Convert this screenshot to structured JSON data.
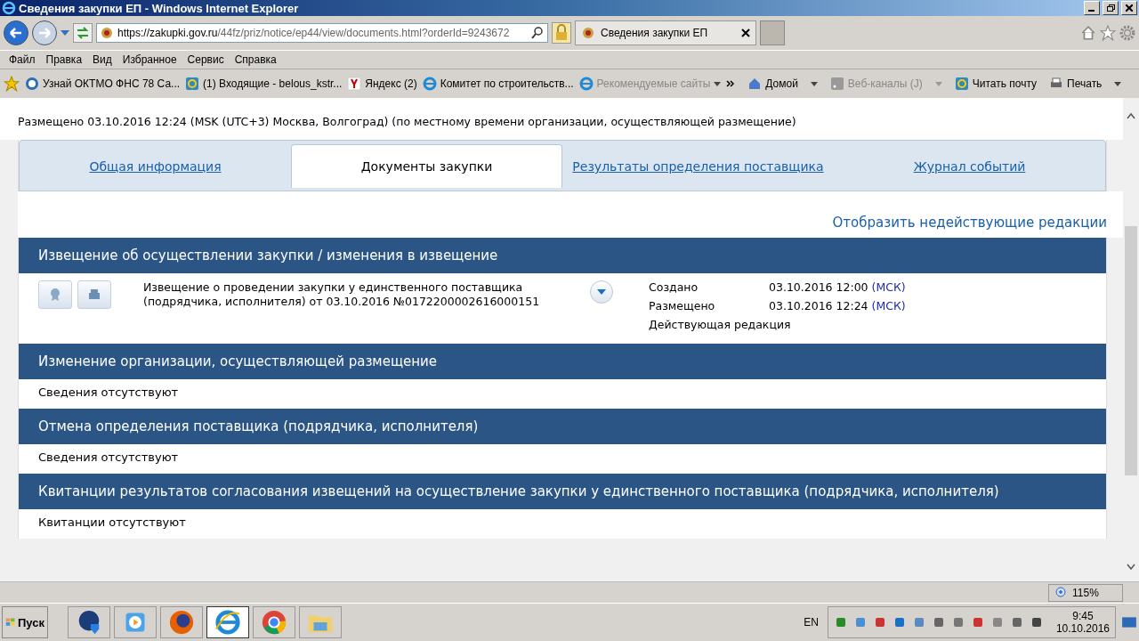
{
  "window": {
    "title": "Сведения закупки ЕП - Windows Internet Explorer"
  },
  "address": {
    "url_host": "https://zakupki.gov.ru",
    "url_path": "/44fz/priz/notice/ep44/view/documents.html?orderId=9243672"
  },
  "browser_tab": {
    "title": "Сведения закупки ЕП"
  },
  "menu": [
    "Файл",
    "Правка",
    "Вид",
    "Избранное",
    "Сервис",
    "Справка"
  ],
  "favorites": [
    {
      "label": "Узнай ОКТМО  ФНС  78 Са...",
      "kind": "site",
      "disabled": false
    },
    {
      "label": "(1) Входящие - belous_kstr...",
      "kind": "mail",
      "disabled": false
    },
    {
      "label": "Яндекс (2)",
      "kind": "yandex",
      "disabled": false
    },
    {
      "label": "Комитет по строительств...",
      "kind": "ie",
      "disabled": false
    },
    {
      "label": "Рекомендуемые сайты",
      "kind": "ie-menu",
      "disabled": true
    }
  ],
  "commands": [
    {
      "label": "Домой",
      "kind": "home",
      "disabled": false
    },
    {
      "label": "Веб-каналы (J)",
      "kind": "feed",
      "disabled": true
    },
    {
      "label": "Читать почту",
      "kind": "mail",
      "disabled": false
    },
    {
      "label": "Печать",
      "kind": "print",
      "disabled": false
    }
  ],
  "page": {
    "posted": "Размещено 03.10.2016 12:24 (MSK (UTC+3) Москва, Волгоград) (по местному времени организации, осуществляющей размещение)",
    "tabs": [
      {
        "label": "Общая информация",
        "selected": false
      },
      {
        "label": "Документы закупки",
        "selected": true
      },
      {
        "label": "Результаты определения поставщика",
        "selected": false
      },
      {
        "label": "Журнал событий",
        "selected": false
      }
    ],
    "show_link": "Отобразить недействующие редакции",
    "sections": [
      {
        "title": "Извещение об осуществлении закупки / изменения в извещение",
        "kind": "document",
        "document": {
          "lines": [
            "Извещение о проведении закупки у единственного поставщика",
            "(подрядчика, исполнителя) от 03.10.2016 №0172200002616000151"
          ],
          "meta": [
            {
              "label": "Создано",
              "value": "03.10.2016 12:00",
              "tz": "(МСК)"
            },
            {
              "label": "Размещено",
              "value": "03.10.2016 12:24",
              "tz": "(МСК)"
            }
          ],
          "status": "Действующая редакция"
        }
      },
      {
        "title": "Изменение организации, осуществляющей размещение",
        "kind": "empty",
        "text": "Сведения отсутствуют"
      },
      {
        "title": "Отмена определения поставщика (подрядчика, исполнителя)",
        "kind": "empty",
        "text": "Сведения отсутствуют"
      },
      {
        "title": "Квитанции результатов согласования извещений на осуществление закупки у единственного поставщика (подрядчика, исполнителя)",
        "kind": "empty",
        "text": "Квитанции отсутствуют"
      }
    ]
  },
  "status_bar": {
    "zoom": "115%"
  },
  "taskbar": {
    "start": "Пуск",
    "apps": [
      {
        "kind": "security",
        "selected": false
      },
      {
        "kind": "media",
        "selected": false
      },
      {
        "kind": "firefox",
        "selected": false
      },
      {
        "kind": "ie",
        "selected": true
      },
      {
        "kind": "chrome",
        "selected": false
      },
      {
        "kind": "folder",
        "selected": false
      }
    ],
    "lang": "EN",
    "time": "9:45",
    "date": "10.10.2016"
  }
}
